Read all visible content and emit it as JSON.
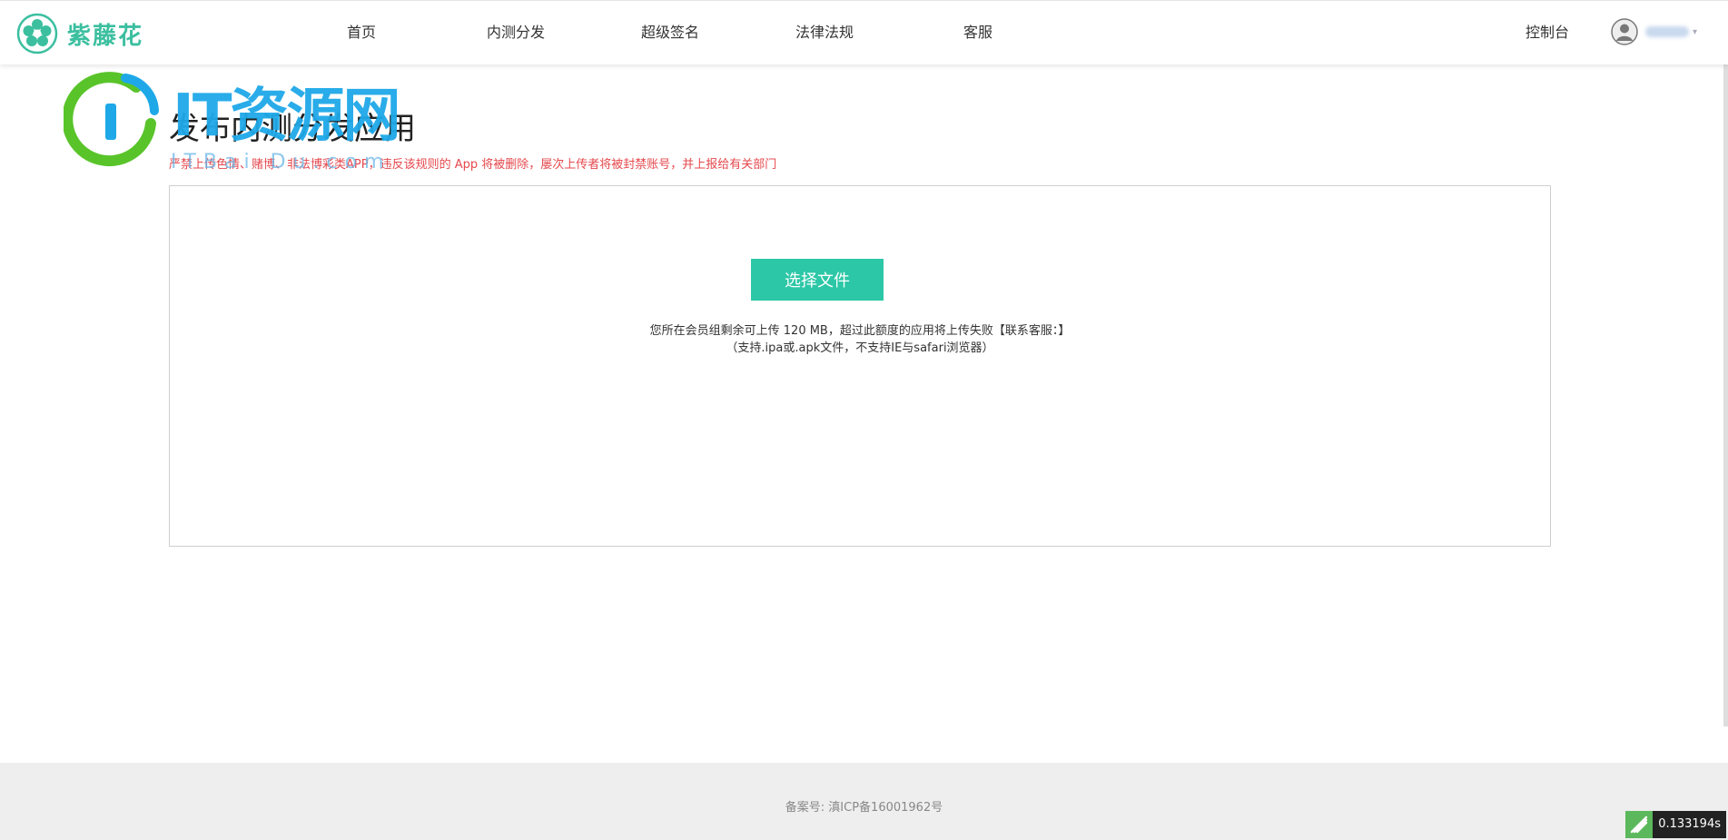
{
  "header": {
    "logo_text": "紫藤花",
    "nav": [
      {
        "label": "首页"
      },
      {
        "label": "内测分发"
      },
      {
        "label": "超级签名"
      },
      {
        "label": "法律法规"
      },
      {
        "label": "客服"
      }
    ],
    "console_label": "控制台"
  },
  "watermark": {
    "text": "IT资源网",
    "sub": "ITBai Du.com"
  },
  "main": {
    "title": "发布内测分发应用",
    "warning": "严禁上传色情、赌博、非法博彩类APP，违反该规则的 App 将被删除，屡次上传者将被封禁账号，并上报给有关部门",
    "upload": {
      "button_label": "选择文件",
      "quota_text": "您所在会员组剩余可上传 120 MB，超过此额度的应用将上传失败【联系客服：】",
      "support_text": "（支持.ipa或.apk文件，不支持IE与safari浏览器）"
    }
  },
  "footer": {
    "icp": "备案号: 滇ICP备16001962号"
  },
  "debug": {
    "timer": "0.133194s"
  },
  "colors": {
    "accent": "#2cc7a6",
    "brand": "#3bbf9f",
    "warning": "#e5484d",
    "footer_bg": "#eeeeee"
  }
}
